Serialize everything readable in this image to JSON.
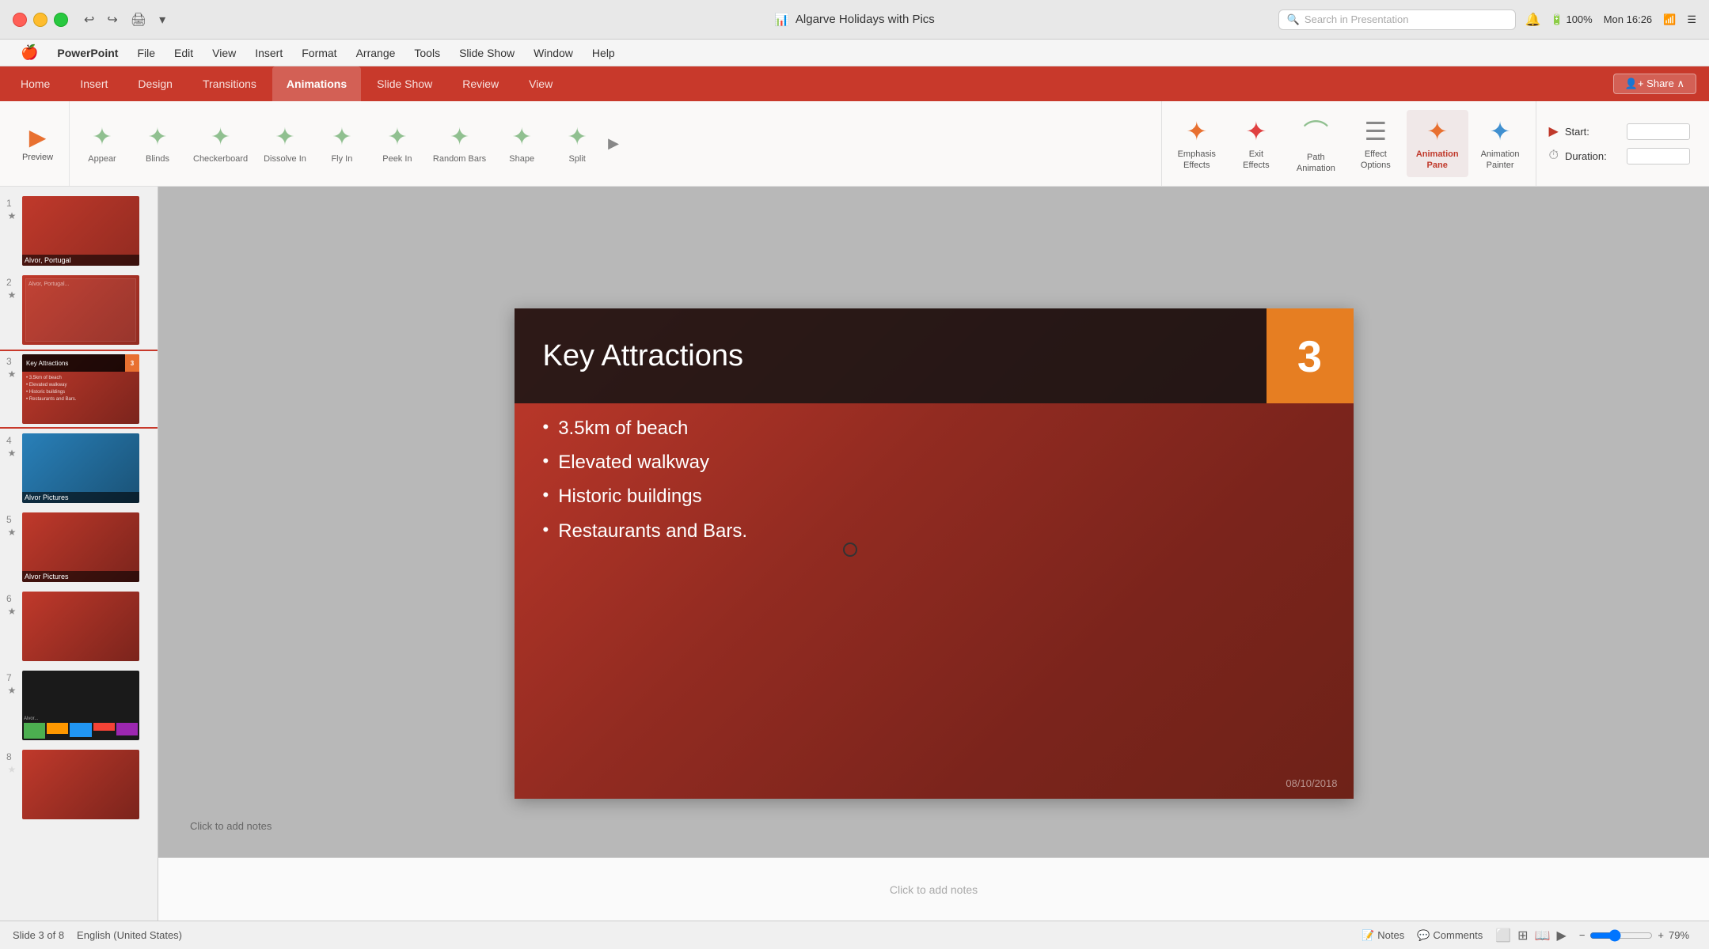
{
  "window": {
    "title": "Algarve Holidays with Pics",
    "icon": "📊"
  },
  "titlebar": {
    "appname": "PowerPoint",
    "menus": [
      "Apple",
      "PowerPoint",
      "File",
      "Edit",
      "View",
      "Insert",
      "Format",
      "Arrange",
      "Tools",
      "Slide Show",
      "Window",
      "Help"
    ],
    "system": {
      "battery": "100%",
      "time": "Mon 16:26",
      "wifi": "WiFi"
    },
    "search_placeholder": "Search in Presentation"
  },
  "tabs": {
    "items": [
      "Home",
      "Insert",
      "Design",
      "Transitions",
      "Animations",
      "Slide Show",
      "Review",
      "View"
    ],
    "active": "Animations"
  },
  "ribbon": {
    "preview_label": "Preview",
    "animations": [
      {
        "label": "Appear",
        "star_color": "green"
      },
      {
        "label": "Blinds",
        "star_color": "green"
      },
      {
        "label": "Checkerboard",
        "star_color": "green"
      },
      {
        "label": "Dissolve In",
        "star_color": "green"
      },
      {
        "label": "Fly In",
        "star_color": "green"
      },
      {
        "label": "Peek In",
        "star_color": "green"
      },
      {
        "label": "Random Bars",
        "star_color": "green"
      },
      {
        "label": "Shape",
        "star_color": "green"
      },
      {
        "label": "Split",
        "star_color": "green"
      }
    ],
    "right_buttons": [
      {
        "label": "Emphasis\nEffects",
        "icon": "✦"
      },
      {
        "label": "Exit\nEffects",
        "icon": "✦"
      },
      {
        "label": "Path\nAnimation",
        "icon": "✦"
      },
      {
        "label": "Effect\nOptions",
        "icon": "☰"
      },
      {
        "label": "Animation\nPane",
        "icon": "✦",
        "active": true
      },
      {
        "label": "Animation\nPainter",
        "icon": "✦"
      }
    ],
    "start_label": "Start:",
    "duration_label": "Duration:",
    "start_value": "",
    "duration_value": ""
  },
  "slides": [
    {
      "num": "1",
      "label": "Slide 1",
      "has_star": true,
      "type": "thumb1",
      "title": "Alvor, Portugal"
    },
    {
      "num": "2",
      "label": "Slide 2",
      "has_star": true,
      "type": "thumb2",
      "title": ""
    },
    {
      "num": "3",
      "label": "Slide 3",
      "has_star": true,
      "type": "thumb3",
      "title": "Key Attractions",
      "active": true
    },
    {
      "num": "4",
      "label": "Slide 4",
      "has_star": true,
      "type": "thumb4",
      "title": "Alvor Pictures"
    },
    {
      "num": "5",
      "label": "Slide 5",
      "has_star": true,
      "type": "thumb5",
      "title": "Alvor Pictures"
    },
    {
      "num": "6",
      "label": "Slide 6",
      "has_star": true,
      "type": "thumb6",
      "title": ""
    },
    {
      "num": "7",
      "label": "Slide 7",
      "has_star": true,
      "type": "thumb7",
      "title": "Alvor..."
    },
    {
      "num": "8",
      "label": "Slide 8",
      "has_star": false,
      "type": "thumb8",
      "title": ""
    }
  ],
  "slide": {
    "title": "Key Attractions",
    "number": "3",
    "bullets": [
      "3.5km of beach",
      "Elevated walkway",
      "Historic buildings",
      "Restaurants and Bars."
    ],
    "date": "08/10/2018"
  },
  "statusbar": {
    "slide_info": "Slide 3 of 8",
    "language": "English (United States)",
    "notes_label": "Notes",
    "comments_label": "Comments",
    "zoom": "79%",
    "notes_hint": "Click to add notes"
  }
}
